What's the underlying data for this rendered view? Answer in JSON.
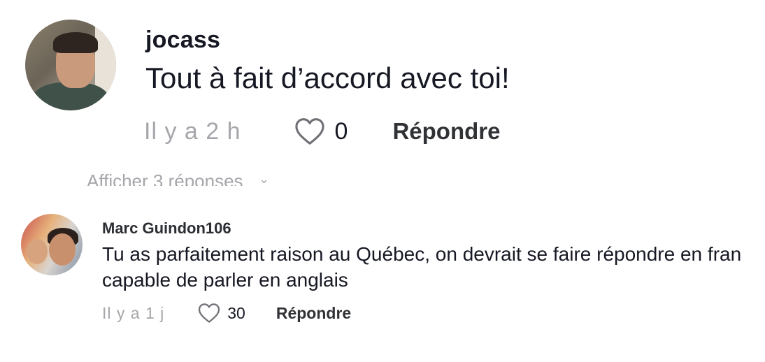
{
  "comments": [
    {
      "username": "jocass",
      "text": "Tout à fait d’accord avec toi!",
      "time": "Il y a 2 h",
      "likes": "0",
      "reply_label": "Répondre",
      "avatar_icon": "user-avatar-photo"
    },
    {
      "username": "Marc Guindon106",
      "text_line1": "Tu as parfaitement raison au Québec, on devrait se faire répondre en fran",
      "text_line2": "capable de parler en anglais",
      "time": "Il y a 1 j",
      "likes": "30",
      "reply_label": "Répondre",
      "avatar_icon": "user-avatar-photo"
    }
  ],
  "hidden_replies": {
    "label": "Afficher 3 réponses",
    "icon": "chevron-down-icon"
  },
  "colors": {
    "text_primary": "#161823",
    "text_muted": "#a6a6ab",
    "reply_text": "#303236"
  }
}
